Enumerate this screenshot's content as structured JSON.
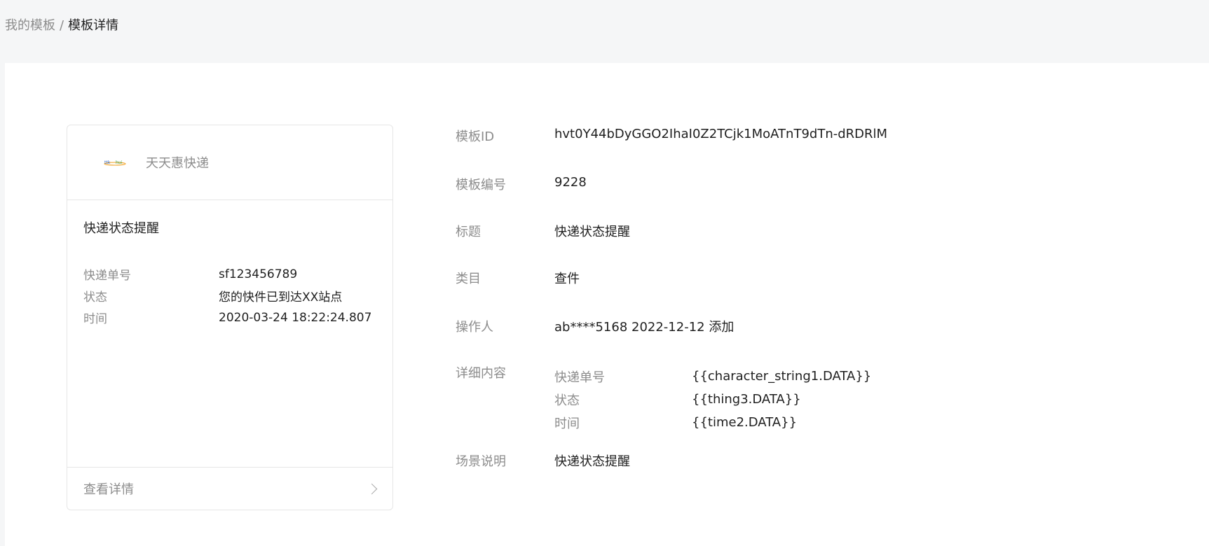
{
  "breadcrumb": {
    "parent": "我的模板",
    "separator": "/",
    "current": "模板详情"
  },
  "preview_card": {
    "brand_logo_icon": "brand-logo-icon",
    "brand_name": "天天惠快递",
    "title": "快递状态提醒",
    "rows": [
      {
        "key": "快递单号",
        "value": "sf123456789"
      },
      {
        "key": "状态",
        "value": "您的快件已到达XX站点"
      },
      {
        "key": "时间",
        "value": "2020-03-24 18:22:24.807"
      }
    ],
    "footer_label": "查看详情",
    "footer_icon": "chevron-right-icon"
  },
  "detail": {
    "template_id": {
      "label": "模板ID",
      "value": "hvt0Y44bDyGGO2IhaI0Z2TCjk1MoATnT9dTn-dRDRlM"
    },
    "template_number": {
      "label": "模板编号",
      "value": "9228"
    },
    "title": {
      "label": "标题",
      "value": "快递状态提醒"
    },
    "category": {
      "label": "类目",
      "value": "查件"
    },
    "operator": {
      "label": "操作人",
      "value": "ab****5168 2022-12-12 添加"
    },
    "content": {
      "label": "详细内容",
      "rows": [
        {
          "key": "快递单号",
          "value": "{{character_string1.DATA}}"
        },
        {
          "key": "状态",
          "value": "{{thing3.DATA}}"
        },
        {
          "key": "时间",
          "value": "{{time2.DATA}}"
        }
      ]
    },
    "scene": {
      "label": "场景说明",
      "value": "快递状态提醒"
    }
  },
  "colors": {
    "page_bg": "#f5f6f7",
    "panel_bg": "#ffffff",
    "border": "#e6e6e6",
    "muted_text": "#8c8c8c",
    "primary_text": "#1f1f1f"
  }
}
